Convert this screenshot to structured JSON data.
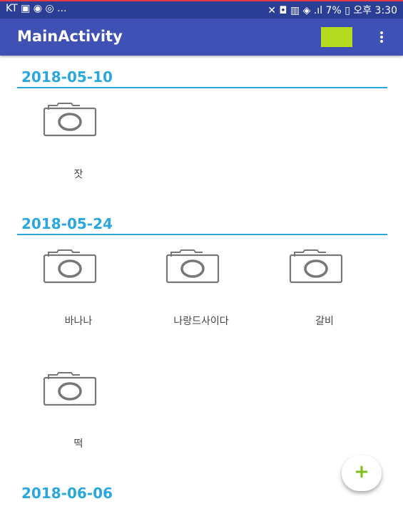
{
  "status_bar": {
    "left_text": "KT ▣ ◉ ◎ ...",
    "right_text": "✕ ◘ ▥ ◈ .ıl 7% ▯ 오후 3:30"
  },
  "app_bar": {
    "title": "MainActivity",
    "swatch_color": "#b5dc1f",
    "overflow_icon": "more-vertical-icon"
  },
  "sections": [
    {
      "date": "2018-05-10",
      "items": [
        {
          "label": "잣",
          "icon": "camera-icon"
        }
      ]
    },
    {
      "date": "2018-05-24",
      "items": [
        {
          "label": "바나나",
          "icon": "camera-icon"
        },
        {
          "label": "나랑드사이다",
          "icon": "camera-icon"
        },
        {
          "label": "갈비",
          "icon": "camera-icon"
        },
        {
          "label": "떡",
          "icon": "camera-icon"
        }
      ]
    },
    {
      "date": "2018-06-06",
      "items": []
    }
  ],
  "fab": {
    "label": "+",
    "icon": "plus-icon",
    "color": "#7cc01e"
  },
  "colors": {
    "primary": "#3f51b5",
    "status_bar": "#2b3e95",
    "accent_date": "#29a8df"
  }
}
